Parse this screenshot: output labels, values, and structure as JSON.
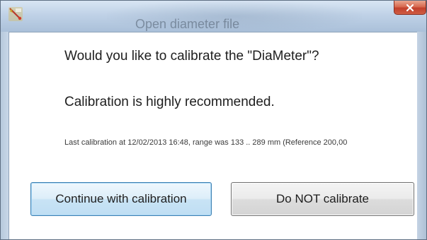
{
  "window": {
    "title": "Open diameter file"
  },
  "dialog": {
    "question": "Would you like to calibrate the \"DiaMeter\"?",
    "recommendation": "Calibration is highly recommended.",
    "last_calibration": "Last calibration at 12/02/2013 16:48, range was 133 .. 289 mm (Reference 200,00"
  },
  "buttons": {
    "continue_label": "Continue with calibration",
    "not_calibrate_label": "Do NOT calibrate"
  },
  "icons": {
    "app": "app-icon",
    "close": "close-icon"
  },
  "colors": {
    "close_button": "#c2402b",
    "default_button_border": "#3c7fb1"
  }
}
